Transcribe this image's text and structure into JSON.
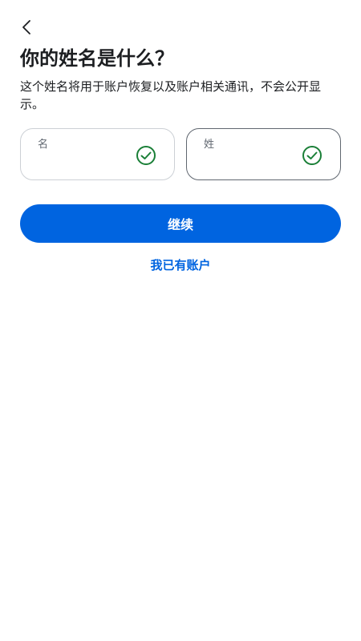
{
  "header": {
    "back_icon": "chevron-left-icon"
  },
  "content": {
    "title": "你的姓名是什么？",
    "subtitle": "这个姓名将用于账户恢复以及账户相关通讯，不会公开显示。"
  },
  "form": {
    "first_name": {
      "label": "名",
      "value": "",
      "status_icon": "check-circle-icon"
    },
    "last_name": {
      "label": "姓",
      "value": "",
      "status_icon": "check-circle-icon"
    }
  },
  "actions": {
    "continue_label": "继续",
    "have_account_label": "我已有账户"
  },
  "colors": {
    "primary": "#0064e0",
    "success": "#1a7f37",
    "text": "#1c1e21",
    "secondary_text": "#606770"
  }
}
